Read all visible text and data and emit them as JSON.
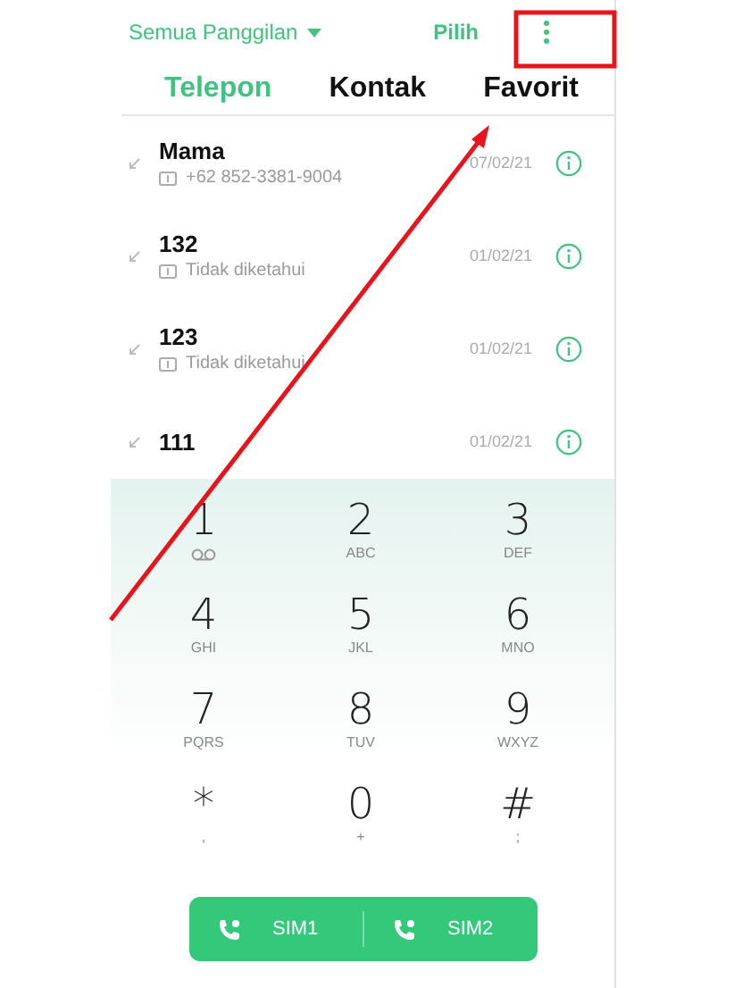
{
  "header": {
    "filter": "Semua Panggilan",
    "select": "Pilih"
  },
  "tabs": [
    {
      "label": "Telepon",
      "selected": true
    },
    {
      "label": "Kontak",
      "selected": false
    },
    {
      "label": "Favorit",
      "selected": false
    }
  ],
  "calls": [
    {
      "name": "Mama",
      "detail": "+62 852-3381-9004",
      "date": "07/02/21"
    },
    {
      "name": "132",
      "detail": "Tidak diketahui",
      "date": "01/02/21"
    },
    {
      "name": "123",
      "detail": "Tidak diketahui",
      "date": "01/02/21"
    },
    {
      "name": "111",
      "date": "01/02/21"
    }
  ],
  "keypad": [
    {
      "digit": "1",
      "kind": "voicemail"
    },
    {
      "digit": "2",
      "letters": "ABC"
    },
    {
      "digit": "3",
      "letters": "DEF"
    },
    {
      "digit": "4",
      "letters": "GHI"
    },
    {
      "digit": "5",
      "letters": "JKL"
    },
    {
      "digit": "6",
      "letters": "MNO"
    },
    {
      "digit": "7",
      "letters": "PQRS"
    },
    {
      "digit": "8",
      "letters": "TUV"
    },
    {
      "digit": "9",
      "letters": "WXYZ"
    },
    {
      "digit": "*",
      "letters": ","
    },
    {
      "digit": "0",
      "letters": "+"
    },
    {
      "digit": "#",
      "letters": ";"
    }
  ],
  "sim_buttons": [
    "SIM1",
    "SIM2"
  ],
  "annotation": {
    "kind": "arrow-to-menu"
  }
}
